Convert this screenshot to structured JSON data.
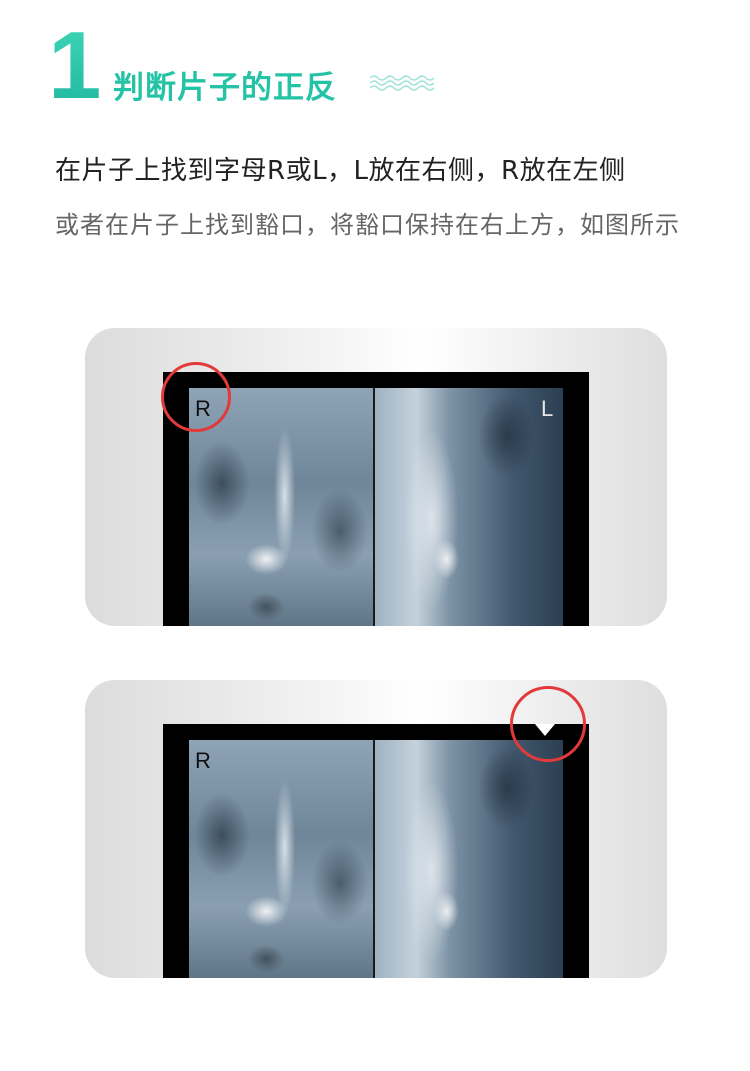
{
  "header": {
    "step_number": "1",
    "title": "判断片子的正反"
  },
  "instructions": {
    "line1": "在片子上找到字母R或L，L放在右侧，R放在左侧",
    "line2": "或者在片子上找到豁口，将豁口保持在右上方，如图所示"
  },
  "examples": [
    {
      "marker_left": "R",
      "marker_right": "L",
      "highlight": "letter-R"
    },
    {
      "marker_left": "R",
      "highlight": "notch"
    }
  ],
  "colors": {
    "accent": "#25c3a6",
    "highlight_circle": "#e23a3a"
  }
}
